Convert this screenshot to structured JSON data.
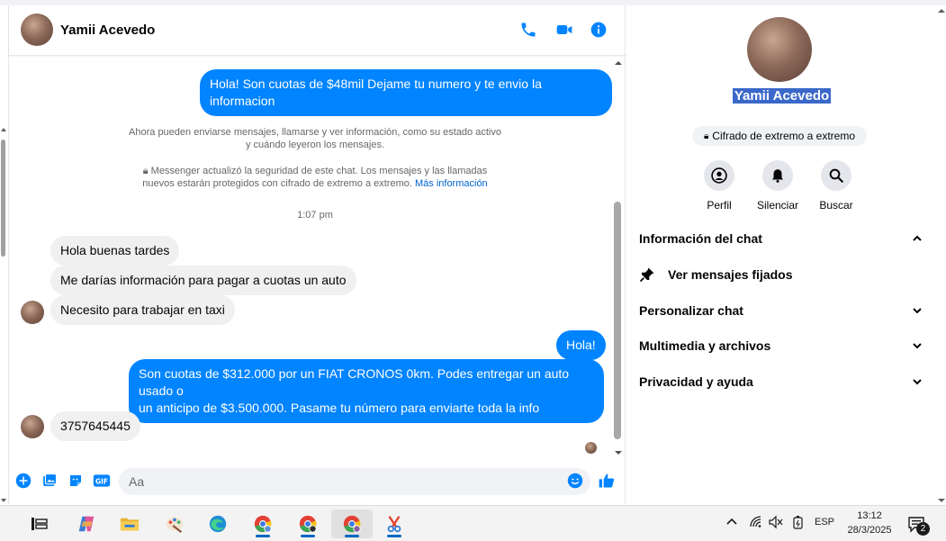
{
  "contact": {
    "name": "Yamii Acevedo"
  },
  "header": {
    "call_icon": "phone-icon",
    "video_icon": "video-icon",
    "info_icon": "info-icon"
  },
  "messages": {
    "out_1": "Hola! Son cuotas de $48mil Dejame tu numero y te envio la informacion",
    "sys_1_line1": "Ahora pueden enviarse mensajes, llamarse y ver información, como su estado activo",
    "sys_1_line2": "y cuándo leyeron los mensajes.",
    "sys_2_line1": "Messenger actualizó la seguridad de este chat. Los mensajes y las llamadas",
    "sys_2_line2": "nuevos estarán protegidos con cifrado de extremo a extremo.",
    "sys_2_link": "Más información",
    "timestamp": "1:07 pm",
    "in_1": "Hola buenas tardes",
    "in_2": "Me darías información para pagar a cuotas un auto",
    "in_3": "Necesito para trabajar en taxi",
    "out_2": "Hola!",
    "out_3_line1": "Son cuotas de $312.000 por un FIAT CRONOS 0km. Podes entregar un auto usado o",
    "out_3_line2": "un anticipo de $3.500.000. Pasame tu número para enviarte toda la info",
    "in_4": "3757645445"
  },
  "composer": {
    "placeholder": "Aa"
  },
  "info_panel": {
    "e2e_label": "Cifrado de extremo a extremo",
    "actions": [
      {
        "label": "Perfil",
        "icon": "profile-icon"
      },
      {
        "label": "Silenciar",
        "icon": "bell-icon"
      },
      {
        "label": "Buscar",
        "icon": "search-icon"
      }
    ],
    "sections": {
      "chat_info": "Información del chat",
      "pinned": "Ver mensajes fijados",
      "customize": "Personalizar chat",
      "media": "Multimedia y archivos",
      "privacy": "Privacidad y ayuda"
    }
  },
  "taskbar": {
    "language": "ESP",
    "time": "13:12",
    "date": "28/3/2025",
    "notifications": "2"
  },
  "colors": {
    "accent": "#0084ff",
    "selection": "#3b68c9"
  }
}
